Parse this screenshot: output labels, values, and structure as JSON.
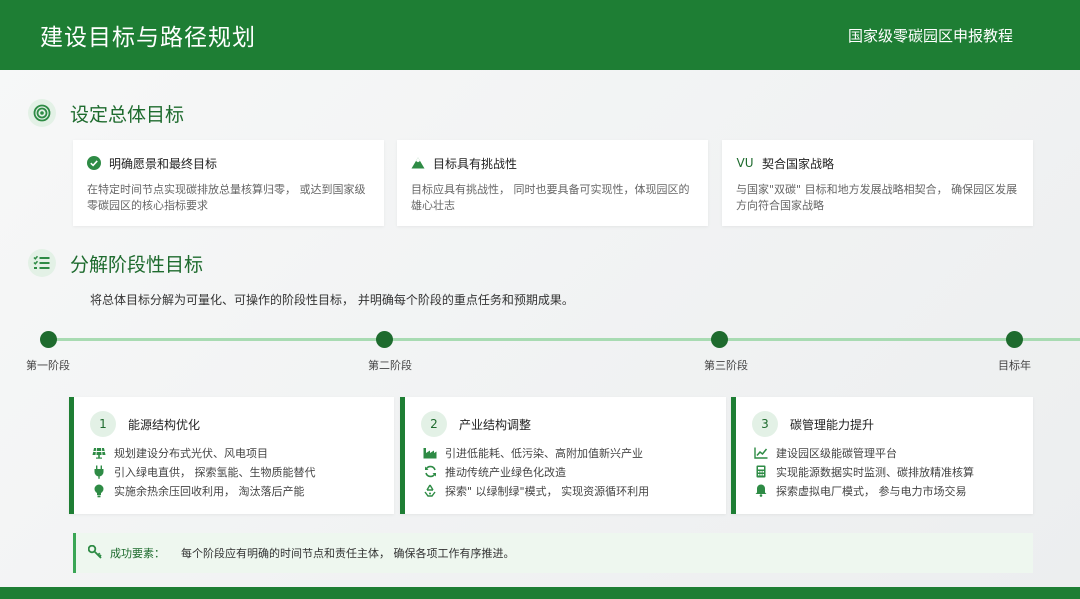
{
  "header": {
    "title": "建设目标与路径规划",
    "subtitle": "国家级零碳园区申报教程"
  },
  "section1": {
    "title": "设定总体目标",
    "icon": "target-icon",
    "cards": [
      {
        "title": "明确愿景和最终目标",
        "icon": "check-circle-icon",
        "desc": "在特定时间节点实现碳排放总量核算归零， 或达到国家级零碳园区的核心指标要求"
      },
      {
        "title": "目标具有挑战性",
        "icon": "mountain-icon",
        "desc": "目标应具有挑战性， 同时也要具备可实现性，体现园区的雄心壮志"
      },
      {
        "title": "契合国家战略",
        "icon": "vu-icon",
        "icon_text": "VU",
        "desc": "与国家\"双碳\" 目标和地方发展战略相契合， 确保园区发展方向符合国家战略"
      }
    ]
  },
  "section2": {
    "title": "分解阶段性目标",
    "icon": "checklist-icon",
    "intro": "将总体目标分解为可量化、可操作的阶段性目标， 并明确每个阶段的重点任务和预期成果。",
    "timeline": [
      "第一阶段",
      "第二阶段",
      "第三阶段",
      "目标年"
    ],
    "stages": [
      {
        "num": "1",
        "title": "能源结构优化",
        "items": [
          {
            "icon": "solar-panel-icon",
            "text": "规划建设分布式光伏、风电项目"
          },
          {
            "icon": "plug-icon",
            "text": "引入绿电直供， 探索氢能、生物质能替代"
          },
          {
            "icon": "lightbulb-icon",
            "text": "实施余热余压回收利用， 淘汰落后产能"
          }
        ]
      },
      {
        "num": "2",
        "title": "产业结构调整",
        "items": [
          {
            "icon": "factory-icon",
            "text": "引进低能耗、低污染、高附加值新兴产业"
          },
          {
            "icon": "refresh-icon",
            "text": "推动传统产业绿色化改造"
          },
          {
            "icon": "recycle-icon",
            "text": "探索\" 以绿制绿\"模式， 实现资源循环利用"
          }
        ]
      },
      {
        "num": "3",
        "title": "碳管理能力提升",
        "items": [
          {
            "icon": "line-chart-icon",
            "text": "建设园区级能碳管理平台"
          },
          {
            "icon": "calculator-icon",
            "text": "实现能源数据实时监测、碳排放精准核算"
          },
          {
            "icon": "bell-icon",
            "text": "探索虚拟电厂模式， 参与电力市场交易"
          }
        ]
      }
    ]
  },
  "key": {
    "icon": "key-icon",
    "label": "成功要素：",
    "text": "每个阶段应有明确的时间节点和责任主体， 确保各项工作有序推进。"
  },
  "colors": {
    "primary": "#1e7e34",
    "dark": "#1e6b2e",
    "light": "#e3f1e6",
    "line": "#a8dbb2"
  }
}
